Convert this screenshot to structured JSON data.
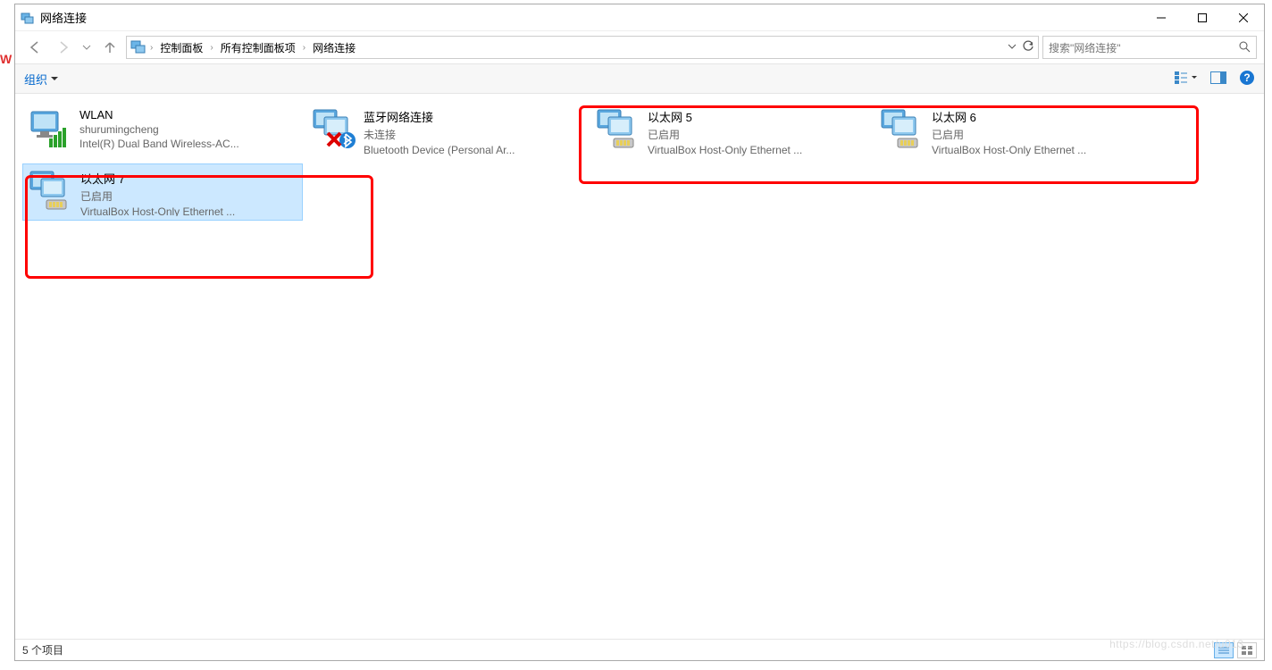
{
  "window": {
    "title": "网络连接"
  },
  "breadcrumbs": [
    "控制面板",
    "所有控制面板项",
    "网络连接"
  ],
  "search": {
    "placeholder": "搜索\"网络连接\""
  },
  "toolbar": {
    "organize": "组织"
  },
  "items": [
    {
      "name": "WLAN",
      "status": "shurumingcheng",
      "device": "Intel(R) Dual Band Wireless-AC...",
      "icon_type": "wifi",
      "selected": false
    },
    {
      "name": "蓝牙网络连接",
      "status": "未连接",
      "device": "Bluetooth Device (Personal Ar...",
      "icon_type": "bluetooth-disabled",
      "selected": false
    },
    {
      "name": "以太网 5",
      "status": "已启用",
      "device": "VirtualBox Host-Only Ethernet ...",
      "icon_type": "ethernet",
      "selected": false
    },
    {
      "name": "以太网 6",
      "status": "已启用",
      "device": "VirtualBox Host-Only Ethernet ...",
      "icon_type": "ethernet",
      "selected": false
    },
    {
      "name": "以太网 7",
      "status": "已启用",
      "device": "VirtualBox Host-Only Ethernet ...",
      "icon_type": "ethernet",
      "selected": true
    }
  ],
  "statusbar": {
    "text": "5 个项目"
  },
  "watermark": "https://blog.csdn.net/u013..."
}
